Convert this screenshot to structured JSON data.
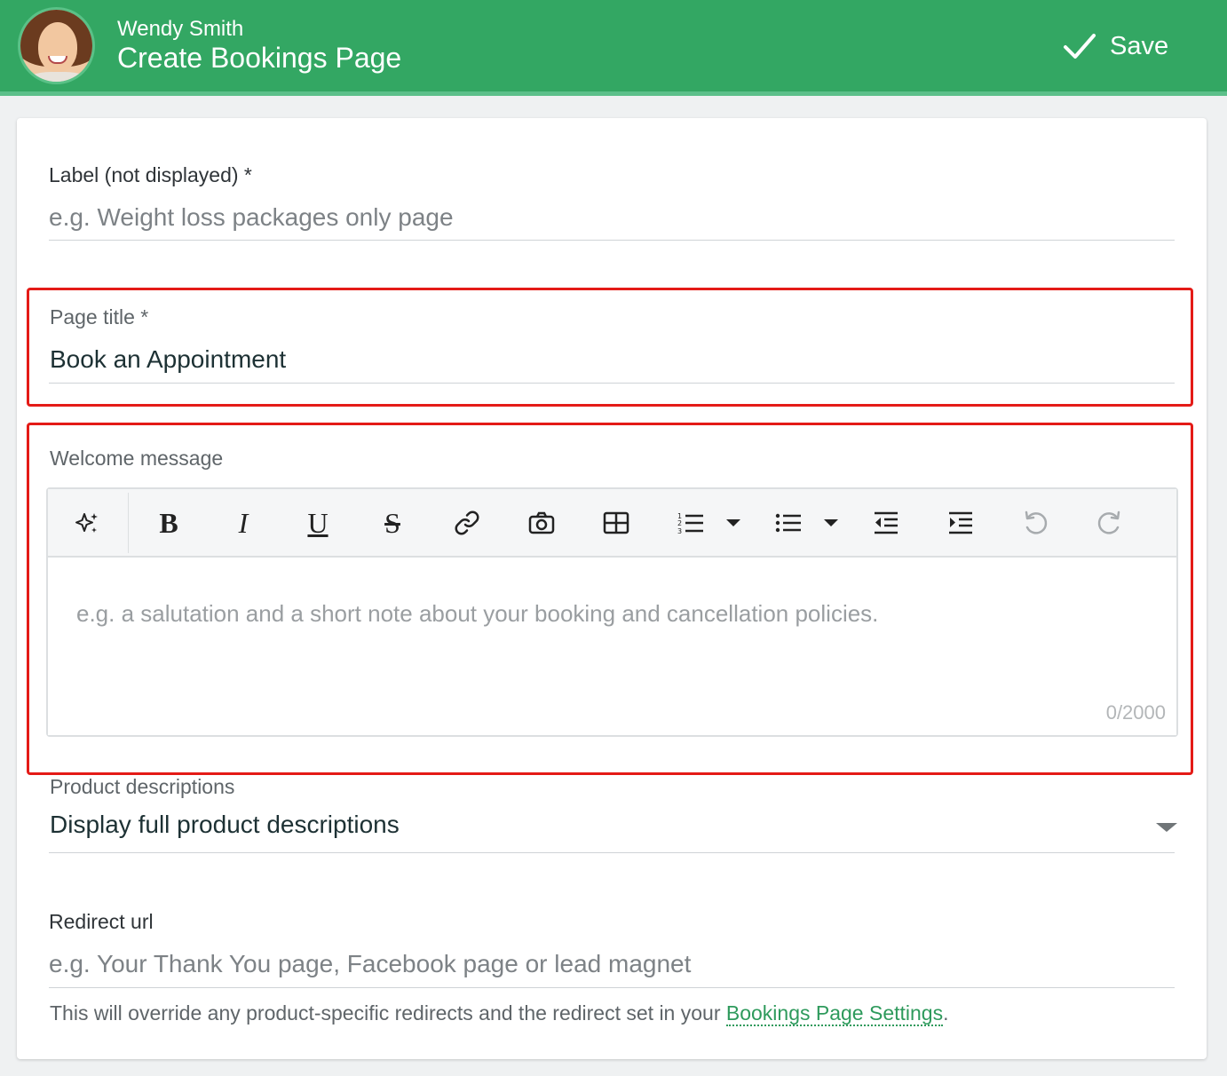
{
  "header": {
    "user_name": "Wendy Smith",
    "title": "Create Bookings Page",
    "save_label": "Save",
    "accent_color": "#33a763"
  },
  "form": {
    "label_field": {
      "label": "Label (not displayed) *",
      "placeholder": "e.g. Weight loss packages only page",
      "value": ""
    },
    "page_title_field": {
      "label": "Page title *",
      "value": "Book an Appointment"
    },
    "welcome_message": {
      "label": "Welcome message",
      "placeholder": "e.g. a salutation and a short note about your booking and cancellation policies.",
      "counter": "0/2000",
      "toolbar": [
        "ai-sparkle-icon",
        "bold-icon",
        "italic-icon",
        "underline-icon",
        "strikethrough-icon",
        "link-icon",
        "camera-icon",
        "table-icon",
        "numbered-list-icon",
        "bulleted-list-icon",
        "outdent-icon",
        "indent-icon",
        "undo-icon",
        "redo-icon"
      ]
    },
    "product_descriptions": {
      "label": "Product descriptions",
      "selected": "Display full product descriptions"
    },
    "redirect_url": {
      "label": "Redirect url",
      "placeholder": "e.g. Your Thank You page, Facebook page or lead magnet",
      "helper_text": "This will override any product-specific redirects and the redirect set in your ",
      "helper_link": "Bookings Page Settings",
      "helper_end": "."
    }
  },
  "highlight_color": "#e41b17"
}
